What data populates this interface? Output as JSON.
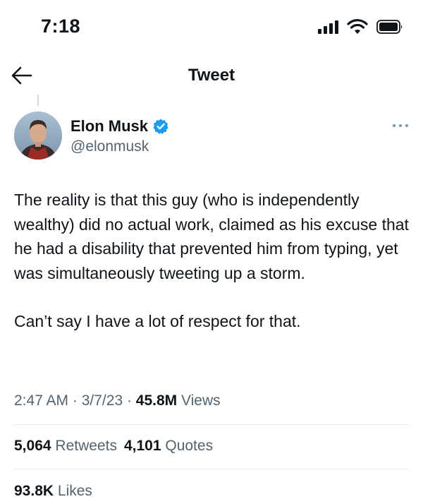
{
  "status_bar": {
    "time": "7:18"
  },
  "header": {
    "title": "Tweet"
  },
  "author": {
    "name": "Elon Musk",
    "handle": "@elonmusk"
  },
  "tweet": {
    "paragraphs": [
      "The reality is that this guy (who is independently wealthy) did no actual work, claimed as his excuse that he had a disability that prevented him from typing, yet was simultaneously tweeting up a storm.",
      "Can’t say I have a lot of respect for that."
    ],
    "time": "2:47 AM",
    "date": "3/7/23",
    "views_count": "45.8M",
    "views_label": "Views"
  },
  "stats": {
    "retweets_count": "5,064",
    "retweets_label": "Retweets",
    "quotes_count": "4,101",
    "quotes_label": "Quotes",
    "likes_count": "93.8K",
    "likes_label": "Likes"
  },
  "icons": {
    "back": "back-arrow-icon",
    "verified": "verified-badge-icon",
    "more": "more-options-icon",
    "signal": "cellular-signal-icon",
    "wifi": "wifi-icon",
    "battery": "battery-icon"
  },
  "colors": {
    "verified_blue": "#1d9bf0",
    "secondary_text": "#536471",
    "primary_text": "#0f1419",
    "divider": "#e6ecf0"
  }
}
